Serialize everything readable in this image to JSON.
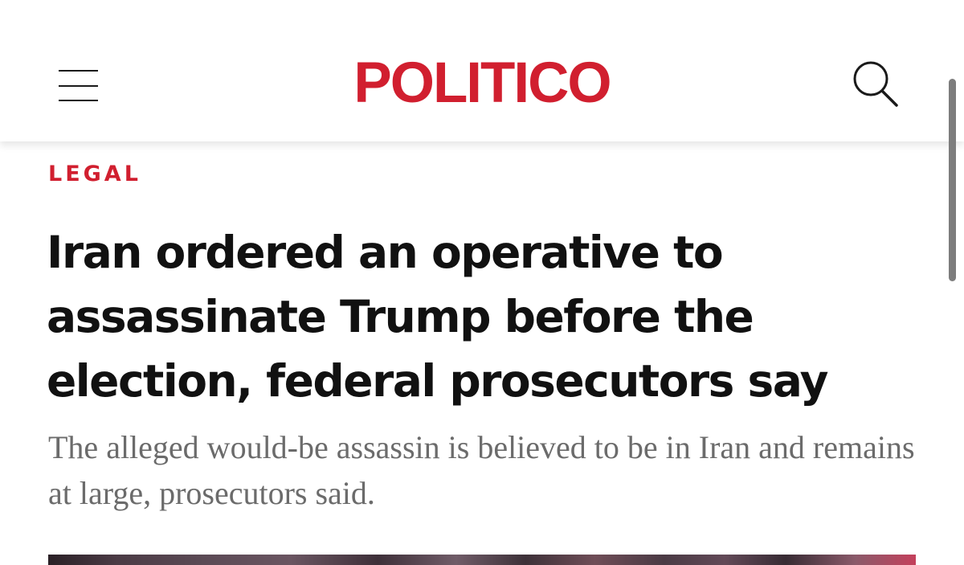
{
  "header": {
    "logo_text": "POLITICO",
    "menu_icon": "hamburger-menu-icon",
    "search_icon": "search-icon"
  },
  "article": {
    "section": "LEGAL",
    "headline": "Iran ordered an operative to assassinate Trump before the election, federal prosecutors say",
    "dek": "The alleged would-be assassin is believed to be in Iran and remains at large, prosecutors said."
  },
  "colors": {
    "brand_red": "#d11f2f",
    "headline_text": "#111111",
    "dek_text": "#6b6b6b"
  }
}
